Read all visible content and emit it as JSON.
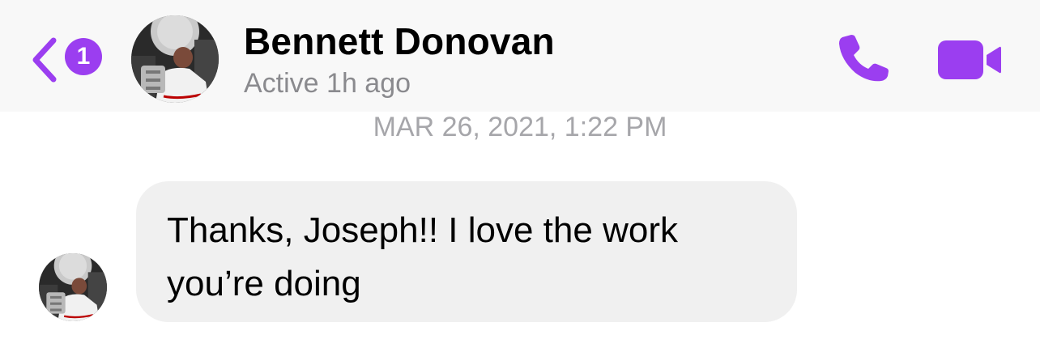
{
  "header": {
    "back_badge": "1",
    "contact_name": "Bennett Donovan",
    "status": "Active 1h ago",
    "call_icon": "phone-icon",
    "video_icon": "video-camera-icon"
  },
  "conversation": {
    "timestamp": "MAR 26, 2021, 1:22 PM",
    "messages": [
      {
        "sender": "Bennett Donovan",
        "text": "Thanks, Joseph!! I love the work you’re doing"
      }
    ]
  },
  "colors": {
    "accent": "#9b3ef0",
    "bubble_incoming": "#f0f0f0",
    "header_bg": "#f8f8f8",
    "secondary_text": "#8a8a8e"
  }
}
